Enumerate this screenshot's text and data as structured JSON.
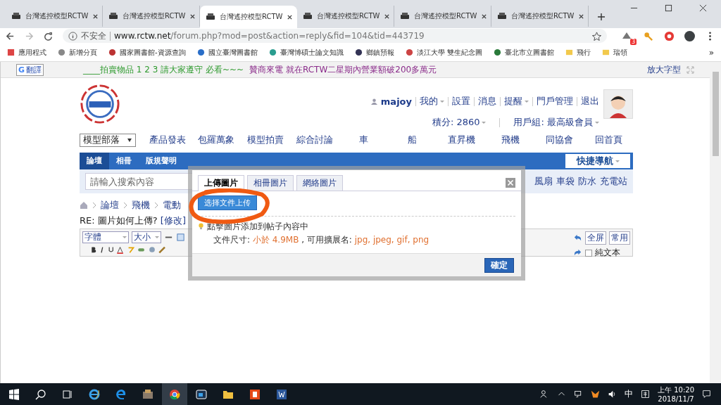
{
  "browser": {
    "tabs": [
      {
        "title": "台灣遙控模型RCTW",
        "selected": false
      },
      {
        "title": "台灣遙控模型RCTW",
        "selected": false
      },
      {
        "title": "台灣遙控模型RCTW",
        "selected": true
      },
      {
        "title": "台灣遙控模型RCTW",
        "selected": false
      },
      {
        "title": "台灣遙控模型RCTW",
        "selected": false
      },
      {
        "title": "台灣遙控模型RCTW",
        "selected": false
      }
    ],
    "security": "不安全",
    "host": "www.rctw.net",
    "path": "/forum.php?mod=post&action=reply&fid=104&tid=443719",
    "extension_badge": "3",
    "more_bookmarks": "»",
    "bookmarks": [
      "應用程式",
      "新增分頁",
      "國家圖書館-資源查詢",
      "國立臺灣圖書館",
      "臺灣博碩士論文知識",
      "鄉鎮預報",
      "淡江大學 雙生紀念圖",
      "臺北市立圖書館",
      "飛行",
      "瑞領"
    ]
  },
  "page": {
    "translate_logo": "G",
    "translate": "翻譯",
    "notices": [
      {
        "text": "____拍賣物品 1 2 3 請大家遵守 必看~~~",
        "color": "#2e9a2e"
      },
      {
        "text": "贊商來電 就在RCTW二星期內營業額破200多萬元",
        "color": "#8a2b8a"
      }
    ],
    "zoom_text": "放大字型",
    "user": {
      "name": "majoy",
      "links": [
        {
          "label": "我的",
          "menu": true
        },
        {
          "label": "設置",
          "menu": false
        },
        {
          "label": "消息",
          "menu": false
        },
        {
          "label": "提醒",
          "menu": true
        },
        {
          "label": "門戶管理",
          "menu": false
        },
        {
          "label": "退出",
          "menu": false
        }
      ],
      "points": "積分: 2860",
      "group": "用戶組: 最高級會員"
    },
    "nav_select": "模型部落",
    "nav_links": [
      "產品發表",
      "包羅萬象",
      "模型拍賣",
      "綜合討論",
      "車",
      "船",
      "直昇機",
      "飛機",
      "同協會",
      "回首頁"
    ],
    "subnav": [
      {
        "label": "論壇",
        "selected": true
      },
      {
        "label": "相冊",
        "selected": false
      },
      {
        "label": "版規聲明",
        "selected": false
      }
    ],
    "quick_nav": "快捷導航",
    "search": {
      "placeholder": "請輸入搜索內容"
    },
    "hot_words": [
      "風扇",
      "車袋",
      "防水",
      "充電站"
    ],
    "breadcrumb": [
      "論壇",
      "飛機",
      "電動"
    ],
    "post_title": "RE: 圖片如何上傳?",
    "edit_link": "[修改]",
    "editor": {
      "font": "字體",
      "size": "大小",
      "buttons": [
        "全屏",
        "常用"
      ],
      "plain_text": {
        "label": "純文本",
        "checked": false
      }
    },
    "dialog": {
      "tabs": [
        {
          "label": "上傳圖片",
          "selected": true
        },
        {
          "label": "相冊圖片",
          "selected": false
        },
        {
          "label": "網絡圖片",
          "selected": false
        }
      ],
      "upload_button": "选择文件上传",
      "hint": "點擊圖片添加到帖子內容中",
      "size_label": "文件尺寸:",
      "size_limit": "小於 4.9MB",
      "ext_label": ", 可用擴展名:",
      "extensions": "jpg, jpeg, gif, png",
      "confirm": "確定"
    }
  },
  "taskbar": {
    "ime": "中",
    "time": "上午 10:20",
    "date": "2018/11/7"
  }
}
